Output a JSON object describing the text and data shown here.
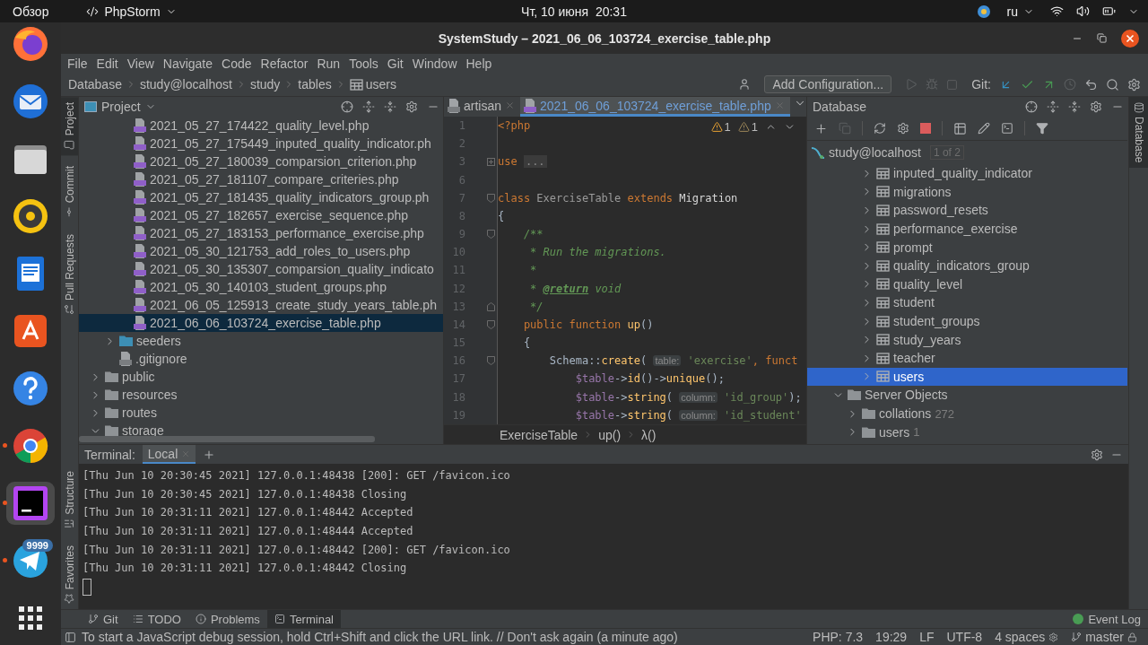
{
  "top_bar": {
    "activities": "Обзор",
    "app": "PhpStorm",
    "clock": "Чт, 10 июня  20:31",
    "language": "ru"
  },
  "dock": [
    {
      "kind": "firefox",
      "running": false,
      "selected": false
    },
    {
      "kind": "thunderbird",
      "running": false,
      "selected": false
    },
    {
      "kind": "files",
      "running": false,
      "selected": false
    },
    {
      "kind": "rhythmbox",
      "running": false,
      "selected": false
    },
    {
      "kind": "writer",
      "running": false,
      "selected": false
    },
    {
      "kind": "software",
      "running": false,
      "selected": false
    },
    {
      "kind": "help",
      "running": false,
      "selected": false
    },
    {
      "kind": "chrome",
      "running": true,
      "selected": false
    },
    {
      "kind": "phpstorm",
      "running": true,
      "selected": true
    },
    {
      "kind": "telegram",
      "running": true,
      "selected": false,
      "badge": "9999"
    },
    {
      "kind": "apps",
      "running": false,
      "selected": false
    }
  ],
  "window": {
    "title": "SystemStudy – 2021_06_06_103724_exercise_table.php"
  },
  "menu": [
    "File",
    "Edit",
    "View",
    "Navigate",
    "Code",
    "Refactor",
    "Run",
    "Tools",
    "Git",
    "Window",
    "Help"
  ],
  "breadcrumbs": [
    {
      "label": "Database",
      "kind": "plain"
    },
    {
      "label": "study@localhost",
      "kind": "plain"
    },
    {
      "label": "study",
      "kind": "plain"
    },
    {
      "label": "tables",
      "kind": "plain"
    },
    {
      "label": "users",
      "kind": "table"
    }
  ],
  "toolbar": {
    "run_config": "Add Configuration...",
    "vcs_label": "Git:"
  },
  "left_tools": [
    {
      "label": "Project",
      "kind": "project",
      "selected": true
    },
    {
      "label": "Commit",
      "kind": "commit",
      "selected": false
    },
    {
      "label": "Pull Requests",
      "kind": "pull-requests",
      "selected": false
    }
  ],
  "left_tools_bottom": [
    {
      "label": "Structure",
      "kind": "structure",
      "selected": false
    },
    {
      "label": "Favorites",
      "kind": "favorites",
      "selected": false
    }
  ],
  "right_tools": [
    {
      "label": "Database",
      "kind": "database",
      "selected": true
    }
  ],
  "project": {
    "title": "Project",
    "tree": [
      {
        "children": [
          {
            "children": [
              {
                "label": "2021_05_27_174422_quality_level.php",
                "kind": "php",
                "selected": false
              },
              {
                "label": "2021_05_27_175449_inputed_quality_indicator.ph",
                "kind": "php",
                "selected": false
              },
              {
                "label": "2021_05_27_180039_comparsion_criterion.php",
                "kind": "php",
                "selected": false
              },
              {
                "label": "2021_05_27_181107_compare_criteries.php",
                "kind": "php",
                "selected": false
              },
              {
                "label": "2021_05_27_181435_quality_indicators_group.ph",
                "kind": "php",
                "selected": false
              },
              {
                "label": "2021_05_27_182657_exercise_sequence.php",
                "kind": "php",
                "selected": false
              },
              {
                "label": "2021_05_27_183153_performance_exercise.php",
                "kind": "php",
                "selected": false
              },
              {
                "label": "2021_05_30_121753_add_roles_to_users.php",
                "kind": "php",
                "selected": false
              },
              {
                "label": "2021_05_30_135307_comparsion_quality_indicato",
                "kind": "php",
                "selected": false
              },
              {
                "label": "2021_05_30_140103_student_groups.php",
                "kind": "php",
                "selected": false
              },
              {
                "label": "2021_06_05_125913_create_study_years_table.ph",
                "kind": "php",
                "selected": false
              },
              {
                "label": "2021_06_06_103724_exercise_table.php",
                "kind": "php",
                "selected": true
              }
            ]
          },
          {
            "label": "seeders",
            "kind": "source-folder",
            "expanded": false,
            "selected": false
          },
          {
            "label": ".gitignore",
            "kind": "ignore",
            "selected": false
          }
        ]
      },
      {
        "label": "public",
        "kind": "folder",
        "expanded": false,
        "selected": false
      },
      {
        "label": "resources",
        "kind": "folder",
        "expanded": false,
        "selected": false
      },
      {
        "label": "routes",
        "kind": "folder",
        "expanded": false,
        "selected": false
      },
      {
        "label": "storage",
        "kind": "folder",
        "expanded": true,
        "selected": false
      }
    ]
  },
  "editor": {
    "tabs": [
      {
        "label": "artisan",
        "kind": "file",
        "selected": false
      },
      {
        "label": "2021_06_06_103724_exercise_table.php",
        "kind": "php",
        "selected": true
      }
    ],
    "inspections": [
      {
        "kind": "warning",
        "count": "1"
      },
      {
        "kind": "weak-warning",
        "count": "1"
      }
    ],
    "lines": [
      {
        "number": "1",
        "tokens": [
          {
            "kind": "tag",
            "text": "<?php"
          }
        ]
      },
      {
        "number": "2"
      },
      {
        "number": "3",
        "folded": true,
        "tokens": [
          {
            "kind": "keyword",
            "text": "use "
          },
          {
            "kind": "folded",
            "text": "..."
          }
        ]
      },
      {
        "number": "6"
      },
      {
        "number": "7",
        "fold_start": true,
        "tokens": [
          {
            "kind": "keyword",
            "text": "class "
          },
          {
            "kind": "dim",
            "text": "ExerciseTable"
          },
          {
            "kind": "keyword",
            "text": " extends "
          },
          {
            "kind": "type",
            "text": "Migration"
          }
        ]
      },
      {
        "number": "8",
        "tokens": [
          {
            "kind": "plain",
            "text": "{"
          }
        ]
      },
      {
        "number": "9",
        "fold_start": true,
        "tokens": [
          {
            "kind": "comment",
            "text": "    /**"
          }
        ]
      },
      {
        "number": "10",
        "tokens": [
          {
            "kind": "comment",
            "text": "     * Run the migrations."
          }
        ]
      },
      {
        "number": "11",
        "tokens": [
          {
            "kind": "comment",
            "text": "     *"
          }
        ]
      },
      {
        "number": "12",
        "tokens": [
          {
            "kind": "comment",
            "text": "     * "
          },
          {
            "kind": "doctag",
            "text": "@return"
          },
          {
            "kind": "comment",
            "text": " void"
          }
        ]
      },
      {
        "number": "13",
        "fold_end": true,
        "tokens": [
          {
            "kind": "comment",
            "text": "     */"
          }
        ]
      },
      {
        "number": "14",
        "fold_start": true,
        "tokens": [
          {
            "kind": "keyword",
            "text": "    public function "
          },
          {
            "kind": "function",
            "text": "up"
          },
          {
            "kind": "plain",
            "text": "()"
          }
        ]
      },
      {
        "number": "15",
        "tokens": [
          {
            "kind": "plain",
            "text": "    {"
          }
        ]
      },
      {
        "number": "16",
        "fold_start": true,
        "tokens": [
          {
            "kind": "plain",
            "text": "        Schema::"
          },
          {
            "kind": "function",
            "text": "create"
          },
          {
            "kind": "plain",
            "text": "( "
          },
          {
            "kind": "hint",
            "text": "table:"
          },
          {
            "kind": "string",
            "text": " 'exercise'"
          },
          {
            "kind": "keyword",
            "text": ", funct"
          }
        ]
      },
      {
        "number": "17",
        "tokens": [
          {
            "kind": "variable",
            "text": "            $table"
          },
          {
            "kind": "plain",
            "text": "->"
          },
          {
            "kind": "function",
            "text": "id"
          },
          {
            "kind": "plain",
            "text": "()->"
          },
          {
            "kind": "function",
            "text": "unique"
          },
          {
            "kind": "plain",
            "text": "();"
          }
        ]
      },
      {
        "number": "18",
        "tokens": [
          {
            "kind": "variable",
            "text": "            $table"
          },
          {
            "kind": "plain",
            "text": "->"
          },
          {
            "kind": "function",
            "text": "string"
          },
          {
            "kind": "plain",
            "text": "( "
          },
          {
            "kind": "hint",
            "text": "column:"
          },
          {
            "kind": "string",
            "text": " 'id_group'"
          },
          {
            "kind": "plain",
            "text": ");"
          }
        ]
      },
      {
        "number": "19",
        "tokens": [
          {
            "kind": "variable",
            "text": "            $table"
          },
          {
            "kind": "plain",
            "text": "->"
          },
          {
            "kind": "function",
            "text": "string"
          },
          {
            "kind": "plain",
            "text": "( "
          },
          {
            "kind": "hint",
            "text": "column:"
          },
          {
            "kind": "string",
            "text": " 'id_student'"
          }
        ]
      }
    ],
    "breadcrumbs": [
      "ExerciseTable",
      "up()",
      "λ()"
    ]
  },
  "database": {
    "title": "Database",
    "tree": [
      {
        "label": "study@localhost",
        "kind": "datasource",
        "badge": "1 of 2",
        "selected": false,
        "children": [
          {
            "children": [
              {
                "children": [
                  {
                    "label": "inputed_quality_indicator",
                    "kind": "table",
                    "expanded": false,
                    "selected": false
                  },
                  {
                    "label": "migrations",
                    "kind": "table",
                    "expanded": false,
                    "selected": false
                  },
                  {
                    "label": "password_resets",
                    "kind": "table",
                    "expanded": false,
                    "selected": false
                  },
                  {
                    "label": "performance_exercise",
                    "kind": "table",
                    "expanded": false,
                    "selected": false
                  },
                  {
                    "label": "prompt",
                    "kind": "table",
                    "expanded": false,
                    "selected": false
                  },
                  {
                    "label": "quality_indicators_group",
                    "kind": "table",
                    "expanded": false,
                    "selected": false
                  },
                  {
                    "label": "quality_level",
                    "kind": "table",
                    "expanded": false,
                    "selected": false
                  },
                  {
                    "label": "student",
                    "kind": "table",
                    "expanded": false,
                    "selected": false
                  },
                  {
                    "label": "student_groups",
                    "kind": "table",
                    "expanded": false,
                    "selected": false
                  },
                  {
                    "label": "study_years",
                    "kind": "table",
                    "expanded": false,
                    "selected": false
                  },
                  {
                    "label": "teacher",
                    "kind": "table",
                    "expanded": false,
                    "selected": false
                  },
                  {
                    "label": "users",
                    "kind": "table",
                    "expanded": false,
                    "selected": true
                  }
                ]
              }
            ]
          },
          {
            "label": "Server Objects",
            "kind": "folder",
            "expanded": true,
            "selected": false,
            "children": [
              {
                "label": "collations",
                "kind": "folder",
                "count": "272",
                "expanded": false,
                "selected": false
              },
              {
                "label": "users",
                "kind": "folder",
                "count": "1",
                "expanded": false,
                "selected": false
              }
            ]
          }
        ]
      }
    ]
  },
  "terminal": {
    "title": "Terminal:",
    "tabs": [
      {
        "label": "Local",
        "selected": true
      }
    ],
    "lines": [
      "[Thu Jun 10 20:30:45 2021] 127.0.0.1:48438 [200]: GET /favicon.ico",
      "[Thu Jun 10 20:30:45 2021] 127.0.0.1:48438 Closing",
      "[Thu Jun 10 20:31:11 2021] 127.0.0.1:48442 Accepted",
      "[Thu Jun 10 20:31:11 2021] 127.0.0.1:48444 Accepted",
      "[Thu Jun 10 20:31:11 2021] 127.0.0.1:48442 [200]: GET /favicon.ico",
      "[Thu Jun 10 20:31:11 2021] 127.0.0.1:48442 Closing"
    ]
  },
  "bottom_tools": [
    {
      "label": "Git",
      "kind": "git",
      "selected": false
    },
    {
      "label": "TODO",
      "kind": "todo",
      "selected": false
    },
    {
      "label": "Problems",
      "kind": "problems",
      "selected": false
    },
    {
      "label": "Terminal",
      "kind": "terminal",
      "selected": true
    }
  ],
  "event_log": "Event Log",
  "status_bar": {
    "message": "To start a JavaScript debug session, hold Ctrl+Shift and click the URL link. // Don't ask again (a minute ago)",
    "items": [
      {
        "kind": "php",
        "text": "PHP: 7.3"
      },
      {
        "kind": "position",
        "text": "19:29"
      },
      {
        "kind": "separator",
        "text": "LF"
      },
      {
        "kind": "encoding",
        "text": "UTF-8"
      },
      {
        "kind": "indent",
        "text": "4 spaces"
      },
      {
        "kind": "branch",
        "text": "master"
      }
    ]
  }
}
